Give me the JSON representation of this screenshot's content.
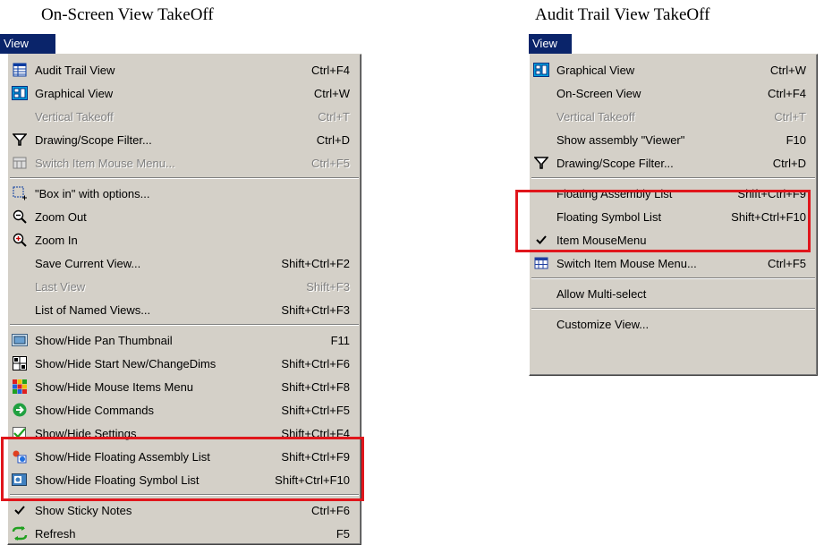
{
  "left_caption": "On-Screen View TakeOff",
  "right_caption": "Audit Trail View TakeOff",
  "left_menu": {
    "menubar_label": "View",
    "items": [
      {
        "label": "Audit Trail View",
        "shortcut": "Ctrl+F4",
        "icon": "table-icon"
      },
      {
        "label": "Graphical View",
        "shortcut": "Ctrl+W",
        "icon": "graphical-view-icon"
      },
      {
        "label": "Vertical Takeoff",
        "shortcut": "Ctrl+T",
        "icon": ""
      },
      {
        "label": "Drawing/Scope Filter...",
        "shortcut": "Ctrl+D",
        "icon": "filter-icon"
      },
      {
        "label": "Switch Item Mouse Menu...",
        "shortcut": "Ctrl+F5",
        "icon": "switch-menu-icon"
      },
      {
        "label": "\"Box in\" with options...",
        "shortcut": "",
        "icon": "box-in-icon"
      },
      {
        "label": "Zoom Out",
        "shortcut": "",
        "icon": "zoom-out-icon"
      },
      {
        "label": "Zoom In",
        "shortcut": "",
        "icon": "zoom-in-icon"
      },
      {
        "label": "Save Current View...",
        "shortcut": "Shift+Ctrl+F2",
        "icon": ""
      },
      {
        "label": "Last View",
        "shortcut": "Shift+F3",
        "icon": ""
      },
      {
        "label": "List of Named Views...",
        "shortcut": "Shift+Ctrl+F3",
        "icon": ""
      },
      {
        "label": "Show/Hide Pan Thumbnail",
        "shortcut": "F11",
        "icon": "pan-thumbnail-icon"
      },
      {
        "label": "Show/Hide Start New/ChangeDims",
        "shortcut": "Shift+Ctrl+F6",
        "icon": "start-new-icon"
      },
      {
        "label": "Show/Hide Mouse Items Menu",
        "shortcut": "Shift+Ctrl+F8",
        "icon": "mouse-items-icon"
      },
      {
        "label": "Show/Hide Commands",
        "shortcut": "Shift+Ctrl+F5",
        "icon": "commands-icon"
      },
      {
        "label": "Show/Hide Settings",
        "shortcut": "Shift+Ctrl+F4",
        "icon": "settings-icon"
      },
      {
        "label": "Show/Hide Floating Assembly List",
        "shortcut": "Shift+Ctrl+F9",
        "icon": "assembly-list-icon"
      },
      {
        "label": "Show/Hide Floating Symbol List",
        "shortcut": "Shift+Ctrl+F10",
        "icon": "symbol-list-icon"
      },
      {
        "label": "Show Sticky Notes",
        "shortcut": "Ctrl+F6",
        "icon": "checkmark-icon"
      },
      {
        "label": "Refresh",
        "shortcut": "F5",
        "icon": "refresh-icon"
      }
    ]
  },
  "right_menu": {
    "menubar_label": "View",
    "items": [
      {
        "label": "Graphical View",
        "shortcut": "Ctrl+W",
        "icon": "graphical-view-icon"
      },
      {
        "label": "On-Screen View",
        "shortcut": "Ctrl+F4",
        "icon": ""
      },
      {
        "label": "Vertical Takeoff",
        "shortcut": "Ctrl+T",
        "icon": ""
      },
      {
        "label": "Show assembly \"Viewer\"",
        "shortcut": "F10",
        "icon": ""
      },
      {
        "label": "Drawing/Scope Filter...",
        "shortcut": "Ctrl+D",
        "icon": "filter-icon"
      },
      {
        "label": "Floating Assembly List",
        "shortcut": "Shift+Ctrl+F9",
        "icon": ""
      },
      {
        "label": "Floating Symbol List",
        "shortcut": "Shift+Ctrl+F10",
        "icon": ""
      },
      {
        "label": "Item MouseMenu",
        "shortcut": "",
        "icon": "checkmark-icon"
      },
      {
        "label": "Switch Item Mouse Menu...",
        "shortcut": "Ctrl+F5",
        "icon": "switch-menu-icon"
      },
      {
        "label": "Allow Multi-select",
        "shortcut": "",
        "icon": ""
      },
      {
        "label": "Customize View...",
        "shortcut": "",
        "icon": ""
      }
    ]
  },
  "colors": {
    "menu_bg": "#d4d0c8",
    "menubar_highlight": "#0a246a",
    "highlight_box": "#e0161c"
  }
}
